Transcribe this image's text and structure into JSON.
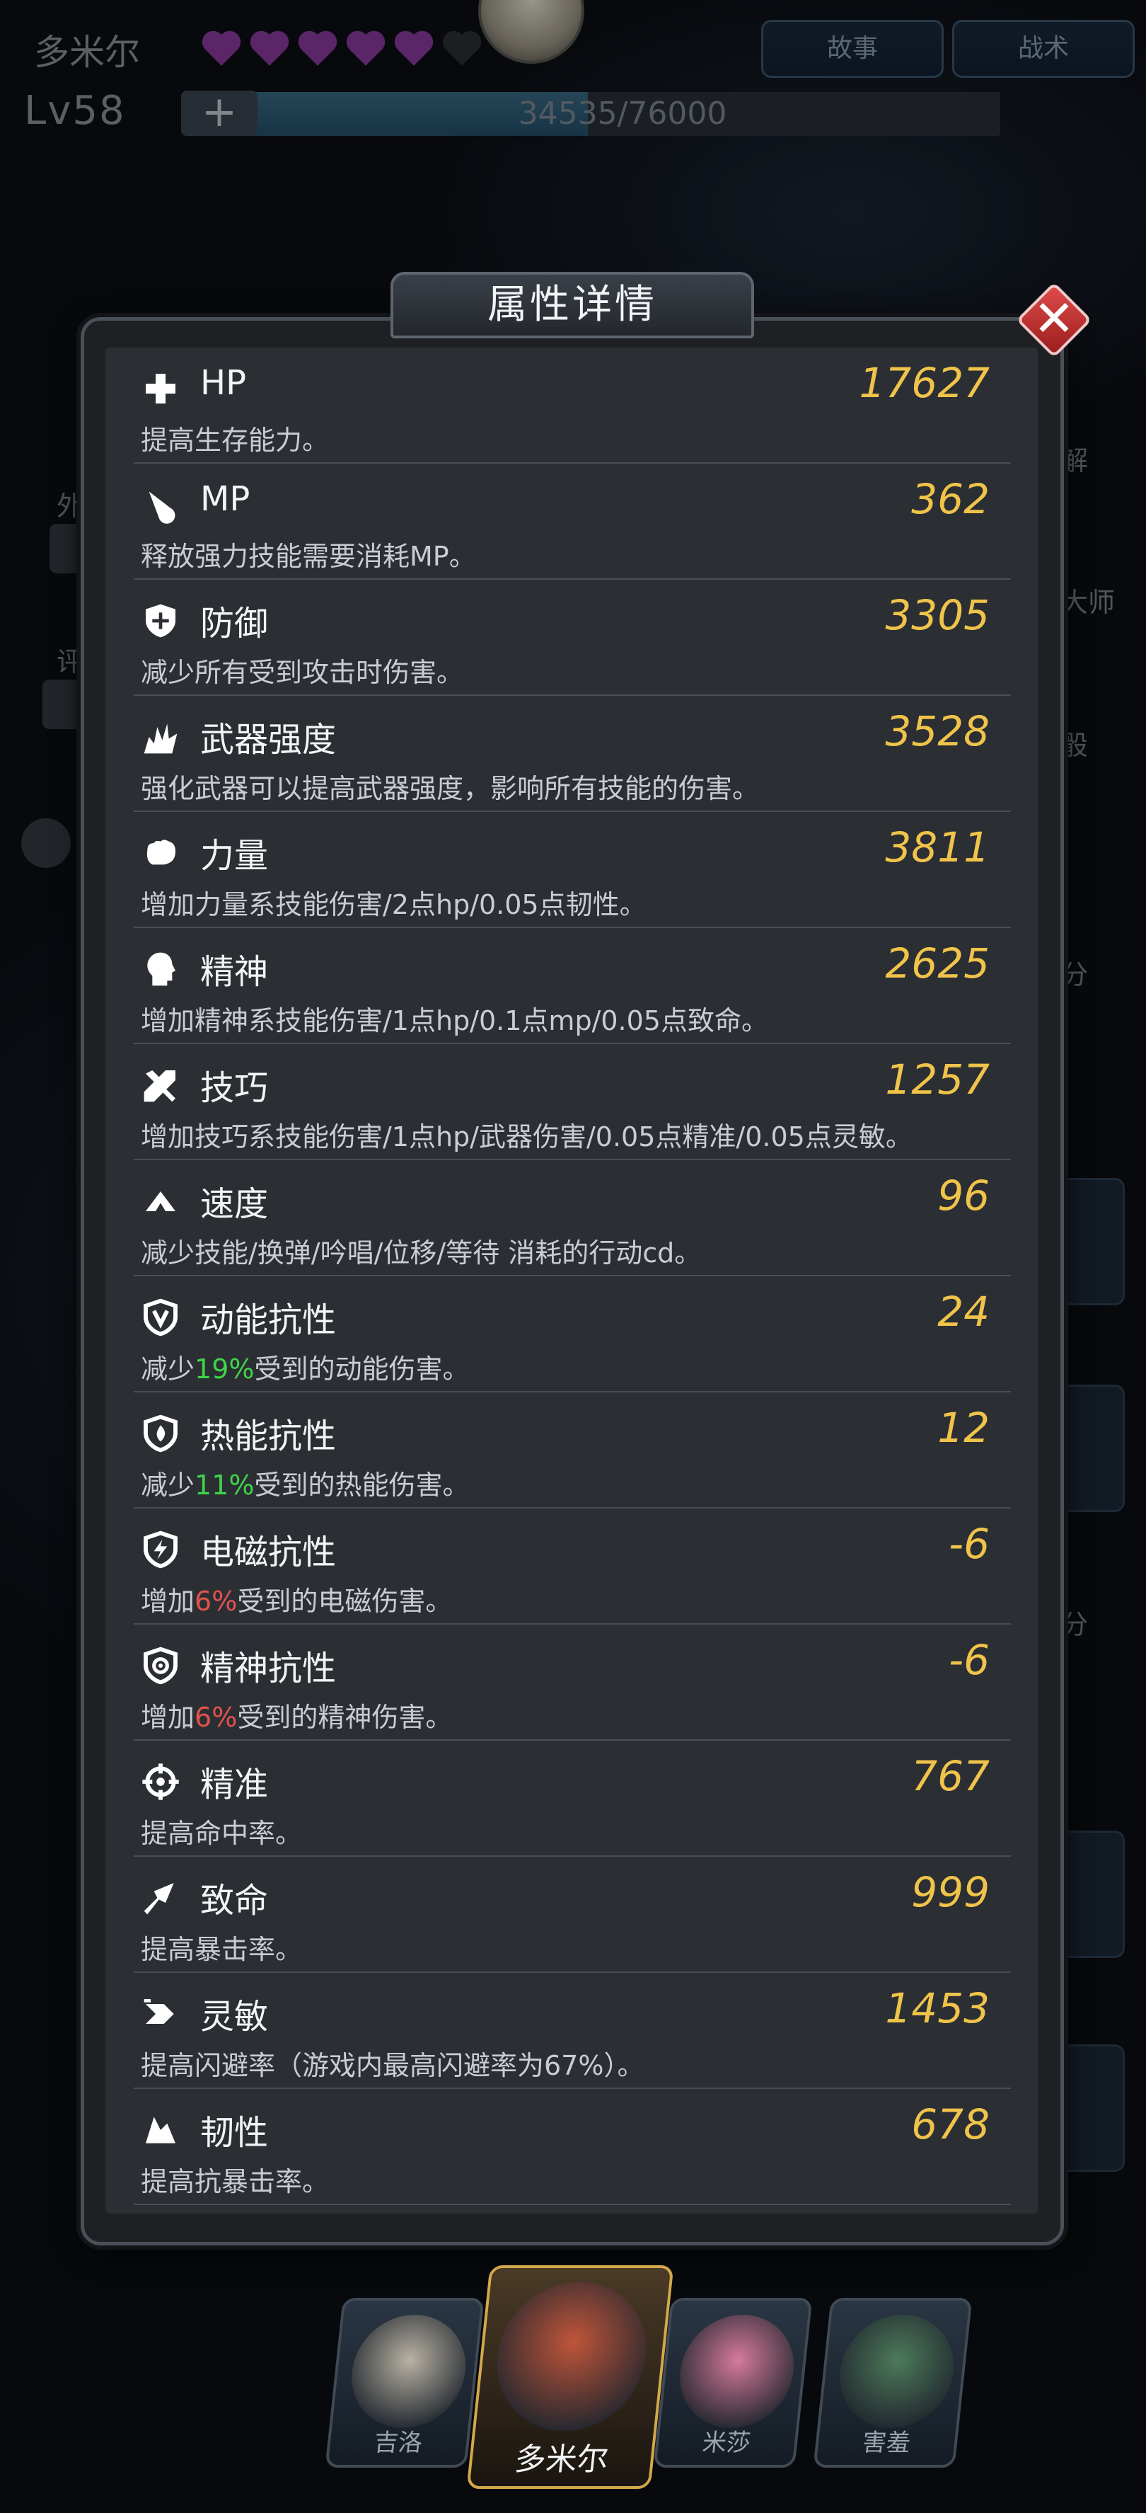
{
  "header": {
    "character_name": "多米尔",
    "hearts_filled": 5,
    "hearts_total": 6,
    "level": "Lv58",
    "xp_text": "34535/76000",
    "xp_progress": 0.454,
    "buttons": {
      "story": "故事",
      "tactics": "战术"
    }
  },
  "background": {
    "side_labels": [
      "外",
      "评",
      "解",
      "大师",
      "骰"
    ],
    "score_label": "分"
  },
  "modal": {
    "title": "属性详情",
    "close_icon": "close-icon",
    "attributes": [
      {
        "icon": "plus-icon",
        "name": "HP",
        "value": "17627",
        "desc": [
          "提高生存能力。"
        ]
      },
      {
        "icon": "droplet-icon",
        "name": "MP",
        "value": "362",
        "desc": [
          "释放强力技能需要消耗MP。"
        ]
      },
      {
        "icon": "shield-icon",
        "name": "防御",
        "value": "3305",
        "desc": [
          "减少所有受到攻击时伤害。"
        ]
      },
      {
        "icon": "explosion-icon",
        "name": "武器强度",
        "value": "3528",
        "desc": [
          "强化武器可以提高武器强度，影响所有技能的伤害。"
        ]
      },
      {
        "icon": "fist-icon",
        "name": "力量",
        "value": "3811",
        "desc": [
          "增加力量系技能伤害/2点hp/0.05点韧性。"
        ]
      },
      {
        "icon": "head-icon",
        "name": "精神",
        "value": "2625",
        "desc": [
          "增加精神系技能伤害/1点hp/0.1点mp/0.05点致命。"
        ]
      },
      {
        "icon": "tools-icon",
        "name": "技巧",
        "value": "1257",
        "desc": [
          "增加技巧系技能伤害/1点hp/武器伤害/0.05点精准/0.05点灵敏。"
        ]
      },
      {
        "icon": "speed-icon",
        "name": "速度",
        "value": "96",
        "desc": [
          "减少技能/换弹/吟唱/位移/等待 消耗的行动cd。"
        ]
      },
      {
        "icon": "kinetic-shield-icon",
        "name": "动能抗性",
        "value": "24",
        "desc": [
          "减少",
          "19%",
          "受到的动能伤害。"
        ],
        "hl": "green"
      },
      {
        "icon": "fire-shield-icon",
        "name": "热能抗性",
        "value": "12",
        "desc": [
          "减少",
          "11%",
          "受到的热能伤害。"
        ],
        "hl": "green"
      },
      {
        "icon": "lightning-shield-icon",
        "name": "电磁抗性",
        "value": "-6",
        "desc": [
          "增加",
          "6%",
          "受到的电磁伤害。"
        ],
        "hl": "red"
      },
      {
        "icon": "spiral-shield-icon",
        "name": "精神抗性",
        "value": "-6",
        "desc": [
          "增加",
          "6%",
          "受到的精神伤害。"
        ],
        "hl": "red"
      },
      {
        "icon": "crosshair-icon",
        "name": "精准",
        "value": "767",
        "desc": [
          "提高命中率。"
        ]
      },
      {
        "icon": "critical-icon",
        "name": "致命",
        "value": "999",
        "desc": [
          "提高暴击率。"
        ]
      },
      {
        "icon": "dodge-icon",
        "name": "灵敏",
        "value": "1453",
        "desc": [
          "提高闪避率（游戏内最高闪避率为67%）。"
        ]
      },
      {
        "icon": "toughness-icon",
        "name": "韧性",
        "value": "678",
        "desc": [
          "提高抗暴击率。"
        ]
      }
    ]
  },
  "characters": [
    {
      "name": "吉洛",
      "active": false,
      "color": "#b9b2a4"
    },
    {
      "name": "多米尔",
      "active": true,
      "color": "#c0553a"
    },
    {
      "name": "米莎",
      "active": false,
      "color": "#d67a9a"
    },
    {
      "name": "害羞",
      "active": false,
      "color": "#4d7a5a"
    }
  ],
  "colors": {
    "value": "#f0c44a",
    "green": "#3fd34a",
    "red": "#e0534f",
    "heart": "#8a3b9e"
  }
}
